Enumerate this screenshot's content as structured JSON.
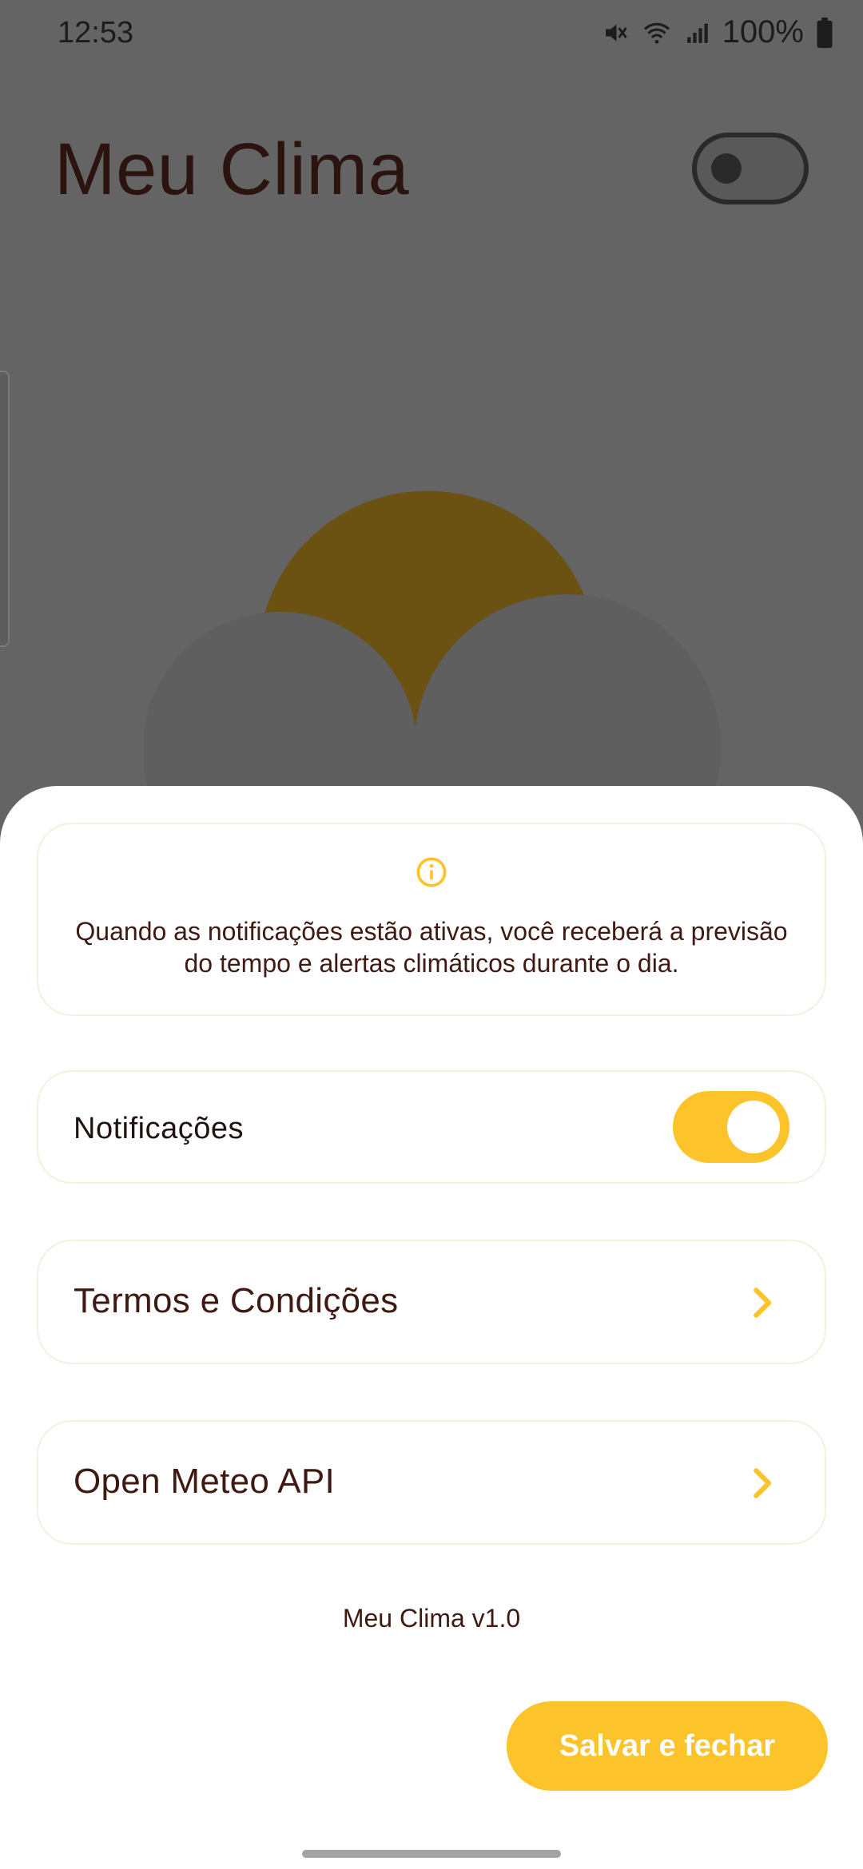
{
  "status_bar": {
    "time": "12:53",
    "battery": "100%",
    "icons": [
      "mute-icon",
      "wifi-icon",
      "signal-icon",
      "battery-icon"
    ]
  },
  "app": {
    "title": "Meu Clima",
    "theme_toggle_on": false
  },
  "illustration": {
    "icon": "partly-cloudy-icon",
    "sun_color": "#6b5112",
    "cloud_color": "#5f5f5f"
  },
  "sheet": {
    "info": {
      "icon": "info-icon",
      "text": "Quando as notificações estão ativas, você receberá a previsão do tempo e alertas climáticos durante o dia."
    },
    "notifications": {
      "label": "Notificações",
      "enabled": true
    },
    "links": [
      {
        "label": "Termos e Condições",
        "icon": "chevron-right-icon"
      },
      {
        "label": "Open Meteo API",
        "icon": "chevron-right-icon"
      }
    ],
    "version": "Meu Clima v1.0",
    "save_label": "Salvar e fechar"
  },
  "colors": {
    "accent": "#fcc42a",
    "text_dark": "#3e1a12",
    "scrim": "#646464"
  }
}
